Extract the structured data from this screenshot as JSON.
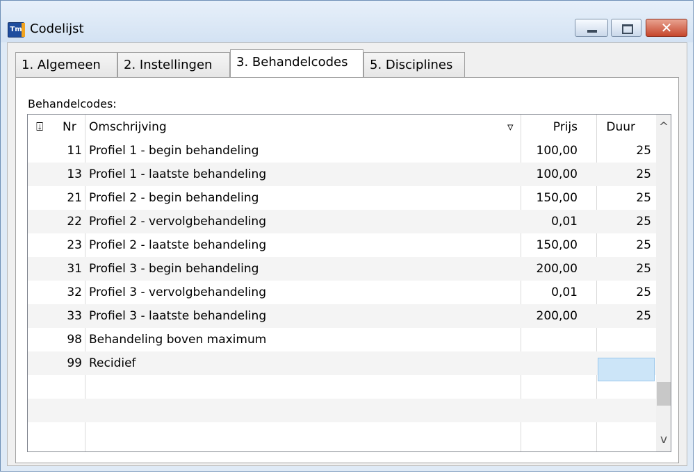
{
  "window": {
    "title": "Codelijst",
    "app_icon": "app-icon",
    "close_glyph": "✕"
  },
  "tabs": [
    {
      "label": "1. Algemeen",
      "active": false
    },
    {
      "label": "2. Instellingen",
      "active": false
    },
    {
      "label": "3. Behandelcodes",
      "active": true
    },
    {
      "label": "5. Disciplines",
      "active": false
    }
  ],
  "section_label": "Behandelcodes:",
  "table": {
    "header_icon": "⍗",
    "columns": {
      "nr": "Nr",
      "desc": "Omschrijving",
      "price": "Prijs",
      "dur": "Duur"
    },
    "sort_indicator": "▿",
    "rows": [
      {
        "nr": "11",
        "desc": "Profiel 1 - begin behandeling",
        "price": "100,00",
        "dur": "25"
      },
      {
        "nr": "13",
        "desc": "Profiel 1 - laatste behandeling",
        "price": "100,00",
        "dur": "25"
      },
      {
        "nr": "21",
        "desc": "Profiel 2 - begin behandeling",
        "price": "150,00",
        "dur": "25"
      },
      {
        "nr": "22",
        "desc": "Profiel 2 - vervolgbehandeling",
        "price": "0,01",
        "dur": "25"
      },
      {
        "nr": "23",
        "desc": "Profiel 2 - laatste behandeling",
        "price": "150,00",
        "dur": "25"
      },
      {
        "nr": "31",
        "desc": "Profiel 3 - begin behandeling",
        "price": "200,00",
        "dur": "25"
      },
      {
        "nr": "32",
        "desc": "Profiel 3 - vervolgbehandeling",
        "price": "0,01",
        "dur": "25"
      },
      {
        "nr": "33",
        "desc": "Profiel 3 - laatste behandeling",
        "price": "200,00",
        "dur": "25"
      },
      {
        "nr": "98",
        "desc": "Behandeling boven maximum",
        "price": "",
        "dur": ""
      },
      {
        "nr": "99",
        "desc": "Recidief",
        "price": "",
        "dur": ""
      }
    ]
  },
  "scrollbar": {
    "up": "^",
    "down": "v"
  },
  "colors": {
    "selection": "#cce5f8",
    "window_frame": "#dfeaf6",
    "close_button": "#c6462c"
  }
}
